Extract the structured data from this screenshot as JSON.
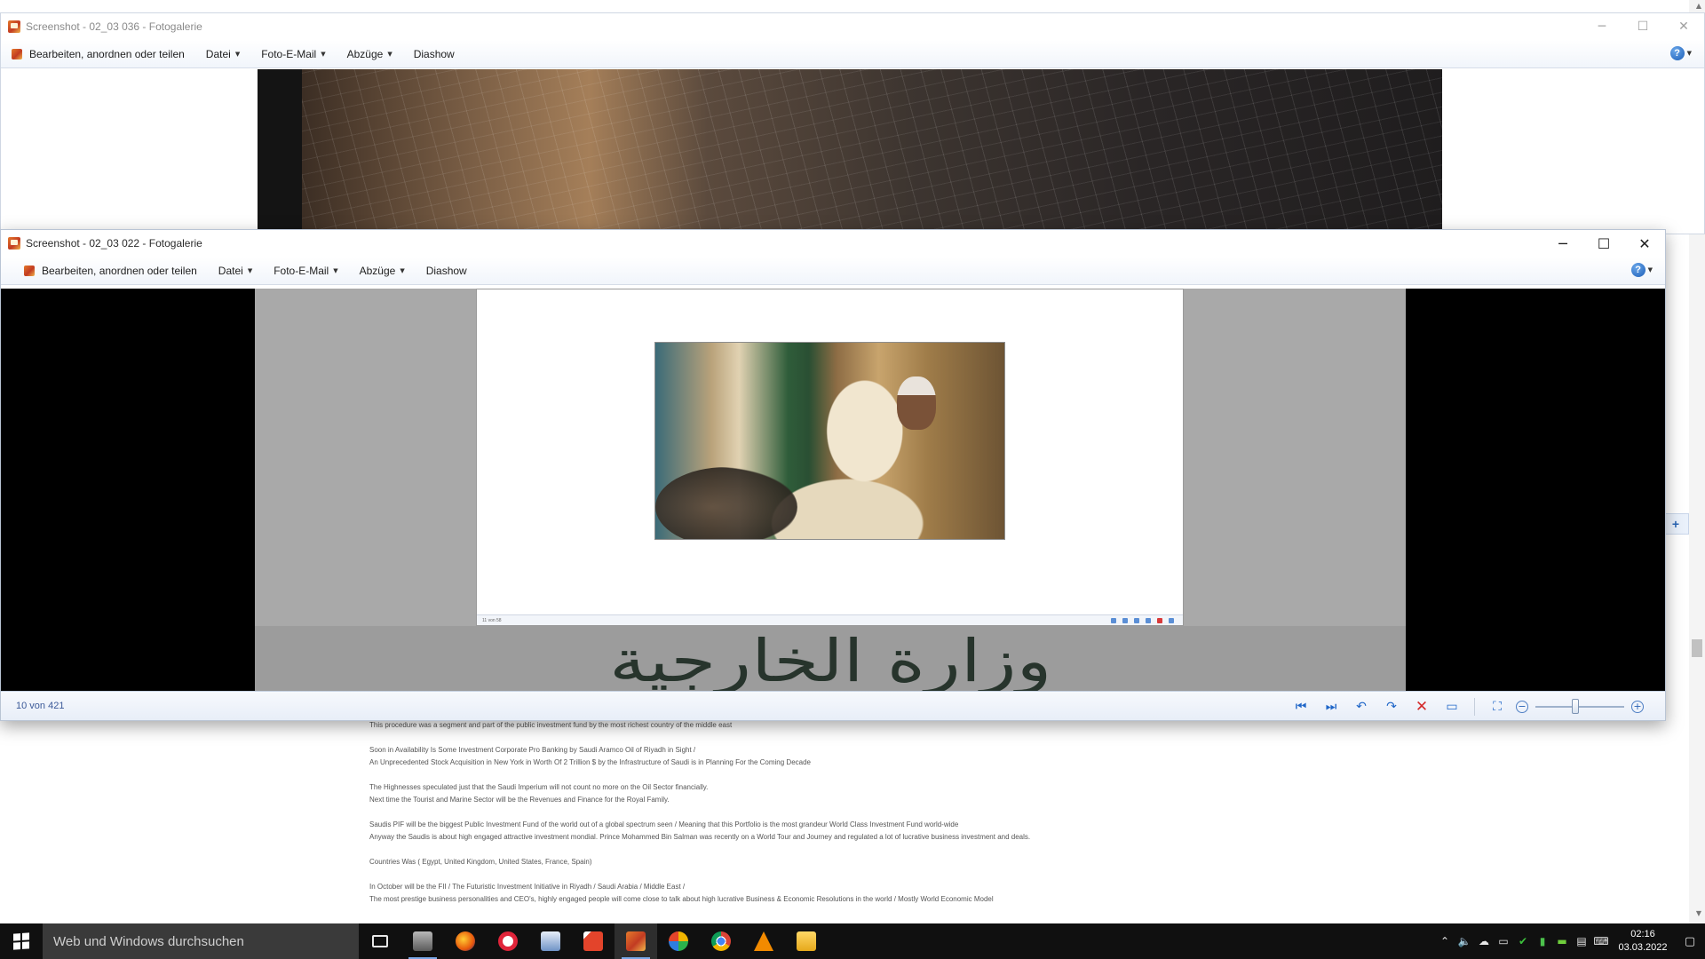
{
  "article": {
    "lines": [
      "This procedure was a segment and part of the  public investment fund by the most richest country of the middle east",
      "Soon in Availability Is Some Investment Corporate Pro Banking by Saudi Aramco Oil of Riyadh in Sight /",
      "An Unprecedented Stock Acquisition in New York in Worth Of 2 Trillion $ by the Infrastructure of Saudi is in Planning For the Coming Decade",
      "The Highnesses speculated just that the Saudi Imperium will not count no more on the Oil Sector financially.",
      "Next time the Tourist and Marine Sector will be the Revenues and Finance for the Royal Family.",
      "Saudis PIF will be the biggest  Public Investment Fund of the world out of a global spectrum seen / Meaning that this Portfolio is the most grandeur World Class  Investment Fund world-wide",
      "Anyway the Saudis is about high engaged attractive investment mondial. Prince Mohammed Bin Salman was recently on a World Tour and Journey  and regulated a lot of lucrative business investment and deals.",
      "Countries Was ( Egypt, United Kingdom, United States, France, Spain)",
      "In October will be the FII / The Futuristic Investment Initiative in Riyadh / Saudi Arabia / Middle East /",
      "The most prestige business personalities and CEO's, highly engaged people will come close to talk about high lucrative Business & Economic Resolutions in the world / Mostly World Economic Model"
    ]
  },
  "back_window": {
    "title": "Screenshot - 02_03 036 - Fotogalerie",
    "menu": {
      "edit_label": "Bearbeiten, anordnen oder teilen",
      "file_label": "Datei",
      "email_label": "Foto-E-Mail",
      "prints_label": "Abzüge",
      "slideshow_label": "Diashow"
    }
  },
  "front_window": {
    "title": "Screenshot - 02_03 022 - Fotogalerie",
    "menu": {
      "edit_label": "Bearbeiten, anordnen oder teilen",
      "file_label": "Datei",
      "email_label": "Foto-E-Mail",
      "prints_label": "Abzüge",
      "slideshow_label": "Diashow"
    },
    "inner_screenshot": {
      "status_text": "11 von 58",
      "arabic_text": "وزارة الخارجية"
    },
    "status": {
      "count_text": "10 von 421",
      "zoom_level": 0.45
    }
  },
  "icons": {
    "window_controls": [
      "minimize-icon",
      "maximize-icon",
      "close-icon"
    ],
    "viewer_controls": [
      "previous-icon",
      "next-icon",
      "rotate-left-icon",
      "rotate-right-icon",
      "delete-icon",
      "slideshow-icon",
      "actual-size-icon",
      "zoom-out-icon",
      "zoom-in-icon"
    ],
    "taskbar": [
      "task-view-icon",
      "file-explorer-icon",
      "firefox-icon",
      "opera-icon",
      "photos-icon",
      "office-icon",
      "photo-gallery-icon",
      "media-icon",
      "chrome-icon",
      "vlc-icon",
      "folder-icon"
    ]
  },
  "taskbar": {
    "search_placeholder": "Web und Windows durchsuchen",
    "time": "02:16",
    "date": "03.03.2022"
  },
  "colors": {
    "accent_blue": "#1f66c8",
    "delete_red": "#d42a2a",
    "taskbar_bg": "#101010",
    "chrome_bg": "#f1f5fb"
  }
}
